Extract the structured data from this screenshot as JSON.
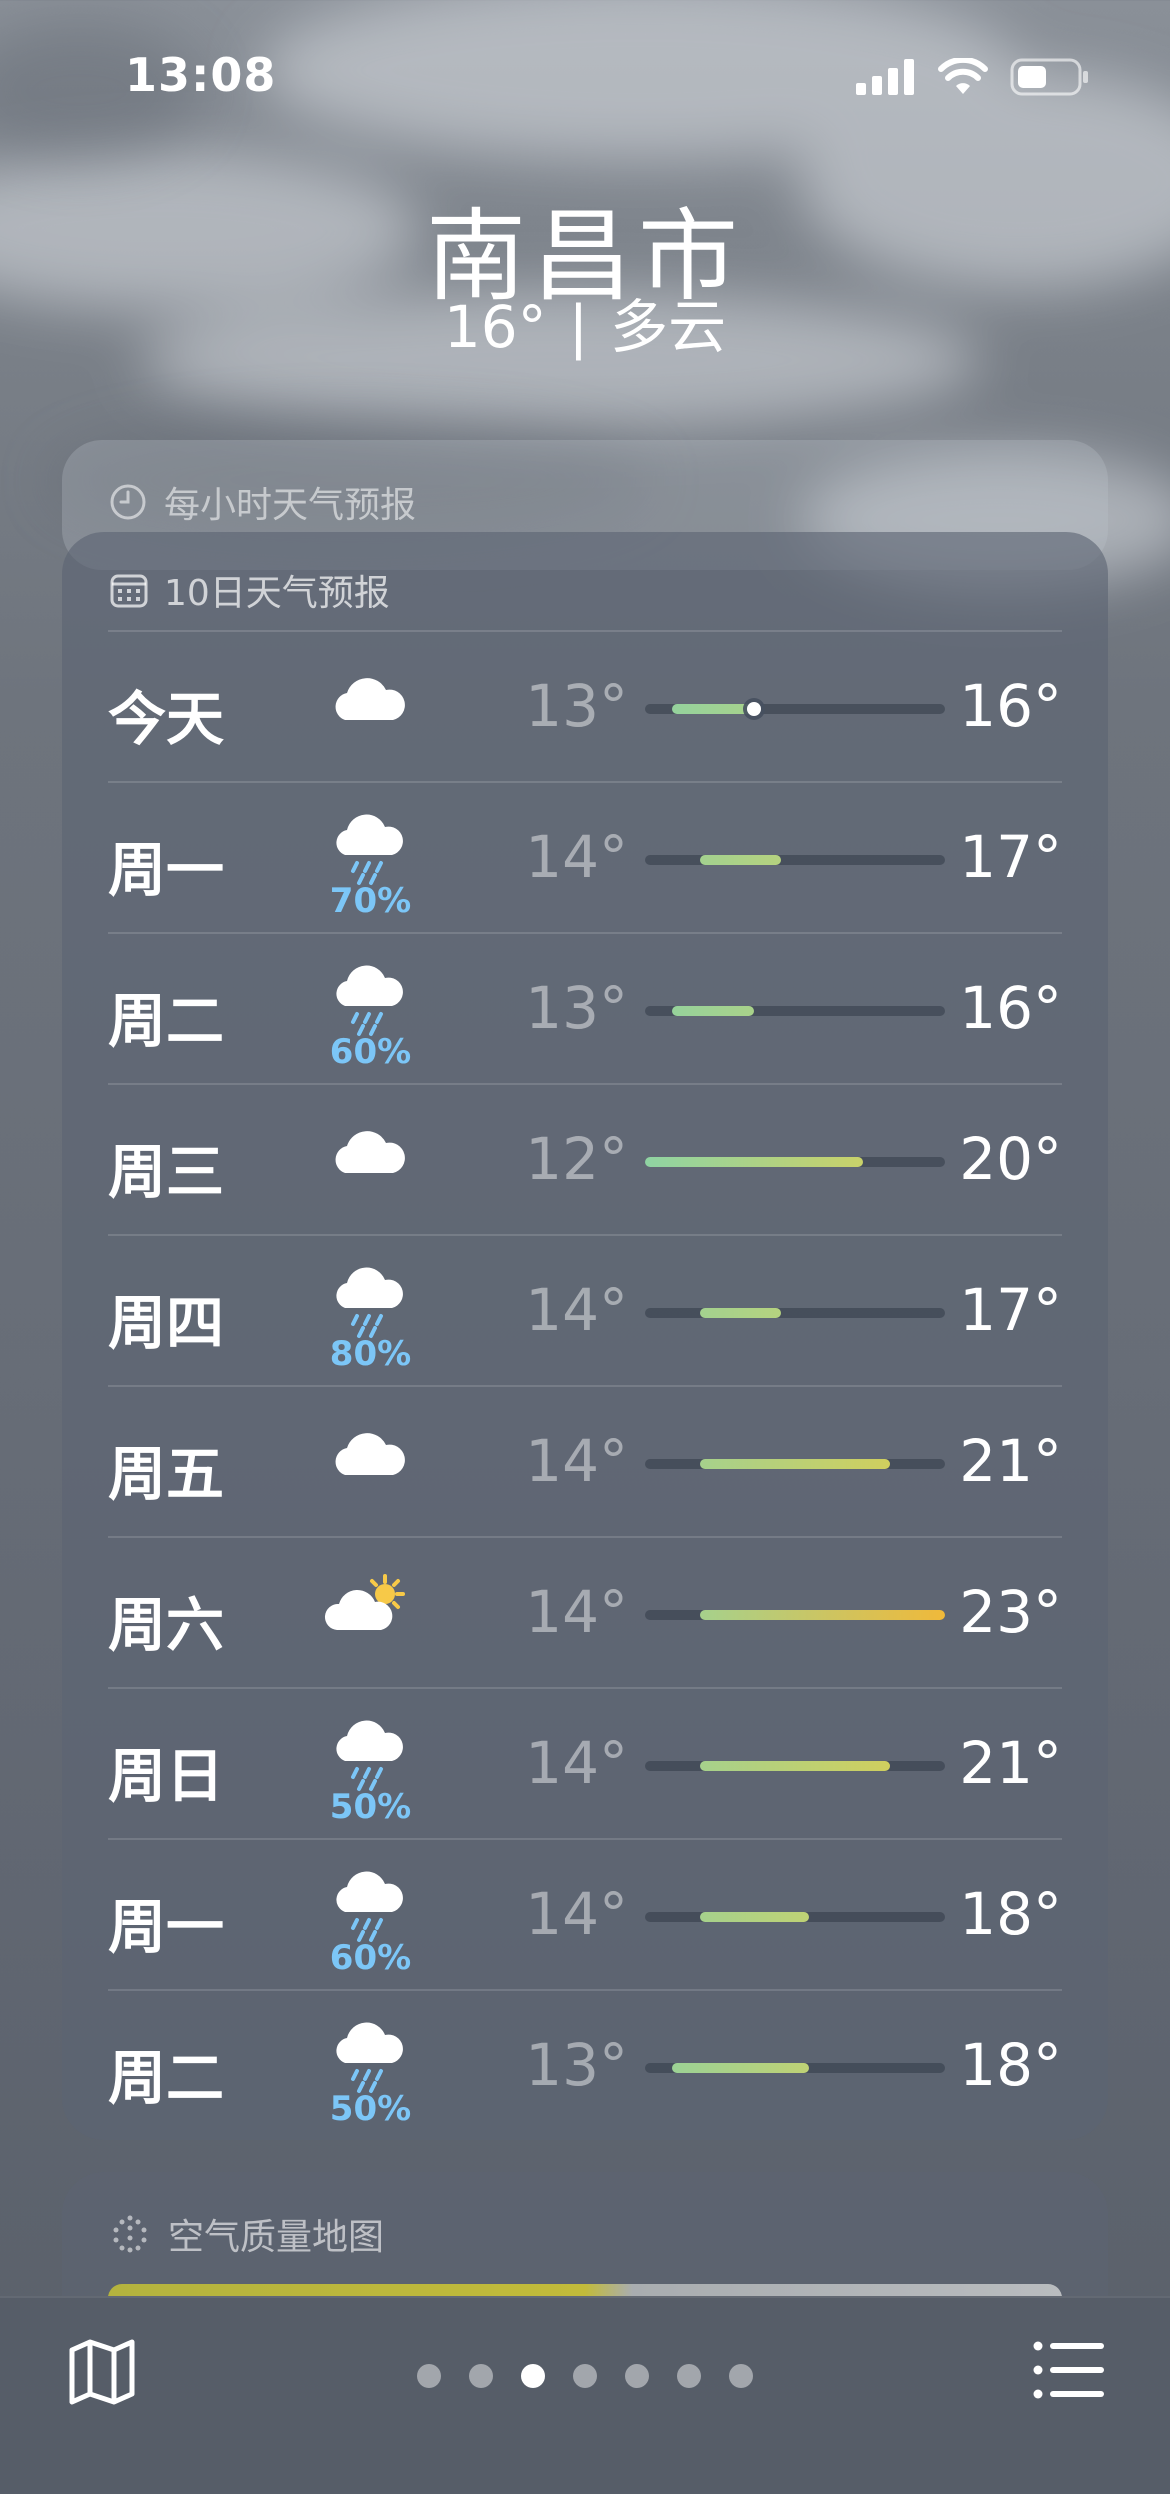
{
  "status_bar": {
    "time": "13:08"
  },
  "location": {
    "city": "南昌市",
    "temperature": "16°",
    "separator": "|",
    "condition": "多云"
  },
  "hourly_card": {
    "title": "每小时天气预报"
  },
  "ten_day": {
    "title": "10日天气预报",
    "scale": {
      "min": 12,
      "max": 23
    },
    "days": [
      {
        "day": "今天",
        "icon": "cloud-icon",
        "precip": "",
        "low": "13°",
        "high": "16°",
        "low_value": 13,
        "high_value": 16,
        "current_value": 16,
        "colors": [
          "#95d29d",
          "#a7d28c"
        ]
      },
      {
        "day": "周一",
        "icon": "cloud-rain-icon",
        "precip": "70%",
        "low": "14°",
        "high": "17°",
        "low_value": 14,
        "high_value": 17,
        "colors": [
          "#a3d18f",
          "#b5d27f"
        ]
      },
      {
        "day": "周二",
        "icon": "cloud-rain-icon",
        "precip": "60%",
        "low": "13°",
        "high": "16°",
        "low_value": 13,
        "high_value": 16,
        "colors": [
          "#96d29b",
          "#a9d28a"
        ]
      },
      {
        "day": "周三",
        "icon": "cloud-icon",
        "precip": "",
        "low": "12°",
        "high": "20°",
        "low_value": 12,
        "high_value": 20,
        "colors": [
          "#8fd3a3",
          "#c9d26a"
        ]
      },
      {
        "day": "周四",
        "icon": "cloud-rain-icon",
        "precip": "80%",
        "low": "14°",
        "high": "17°",
        "low_value": 14,
        "high_value": 17,
        "colors": [
          "#a3d18f",
          "#b5d27f"
        ]
      },
      {
        "day": "周五",
        "icon": "cloud-icon",
        "precip": "",
        "low": "14°",
        "high": "21°",
        "low_value": 14,
        "high_value": 21,
        "colors": [
          "#a6d18c",
          "#d0cf5e"
        ]
      },
      {
        "day": "周六",
        "icon": "partly-sunny-icon",
        "precip": "",
        "low": "14°",
        "high": "23°",
        "low_value": 14,
        "high_value": 23,
        "colors": [
          "#a6d18c",
          "#f0b93a"
        ]
      },
      {
        "day": "周日",
        "icon": "cloud-rain-icon",
        "precip": "50%",
        "low": "14°",
        "high": "21°",
        "low_value": 14,
        "high_value": 21,
        "colors": [
          "#a6d18c",
          "#d0cf5e"
        ]
      },
      {
        "day": "周一",
        "icon": "cloud-rain-icon",
        "precip": "60%",
        "low": "14°",
        "high": "18°",
        "low_value": 14,
        "high_value": 18,
        "colors": [
          "#a6d18c",
          "#bfd275"
        ]
      },
      {
        "day": "周二",
        "icon": "cloud-rain-icon",
        "precip": "50%",
        "low": "13°",
        "high": "18°",
        "low_value": 13,
        "high_value": 18,
        "colors": [
          "#9cd295",
          "#bfd275"
        ]
      }
    ]
  },
  "air_quality_card": {
    "title": "空气质量地图"
  },
  "bottom_bar": {
    "pages": 7,
    "active_page": 3
  }
}
